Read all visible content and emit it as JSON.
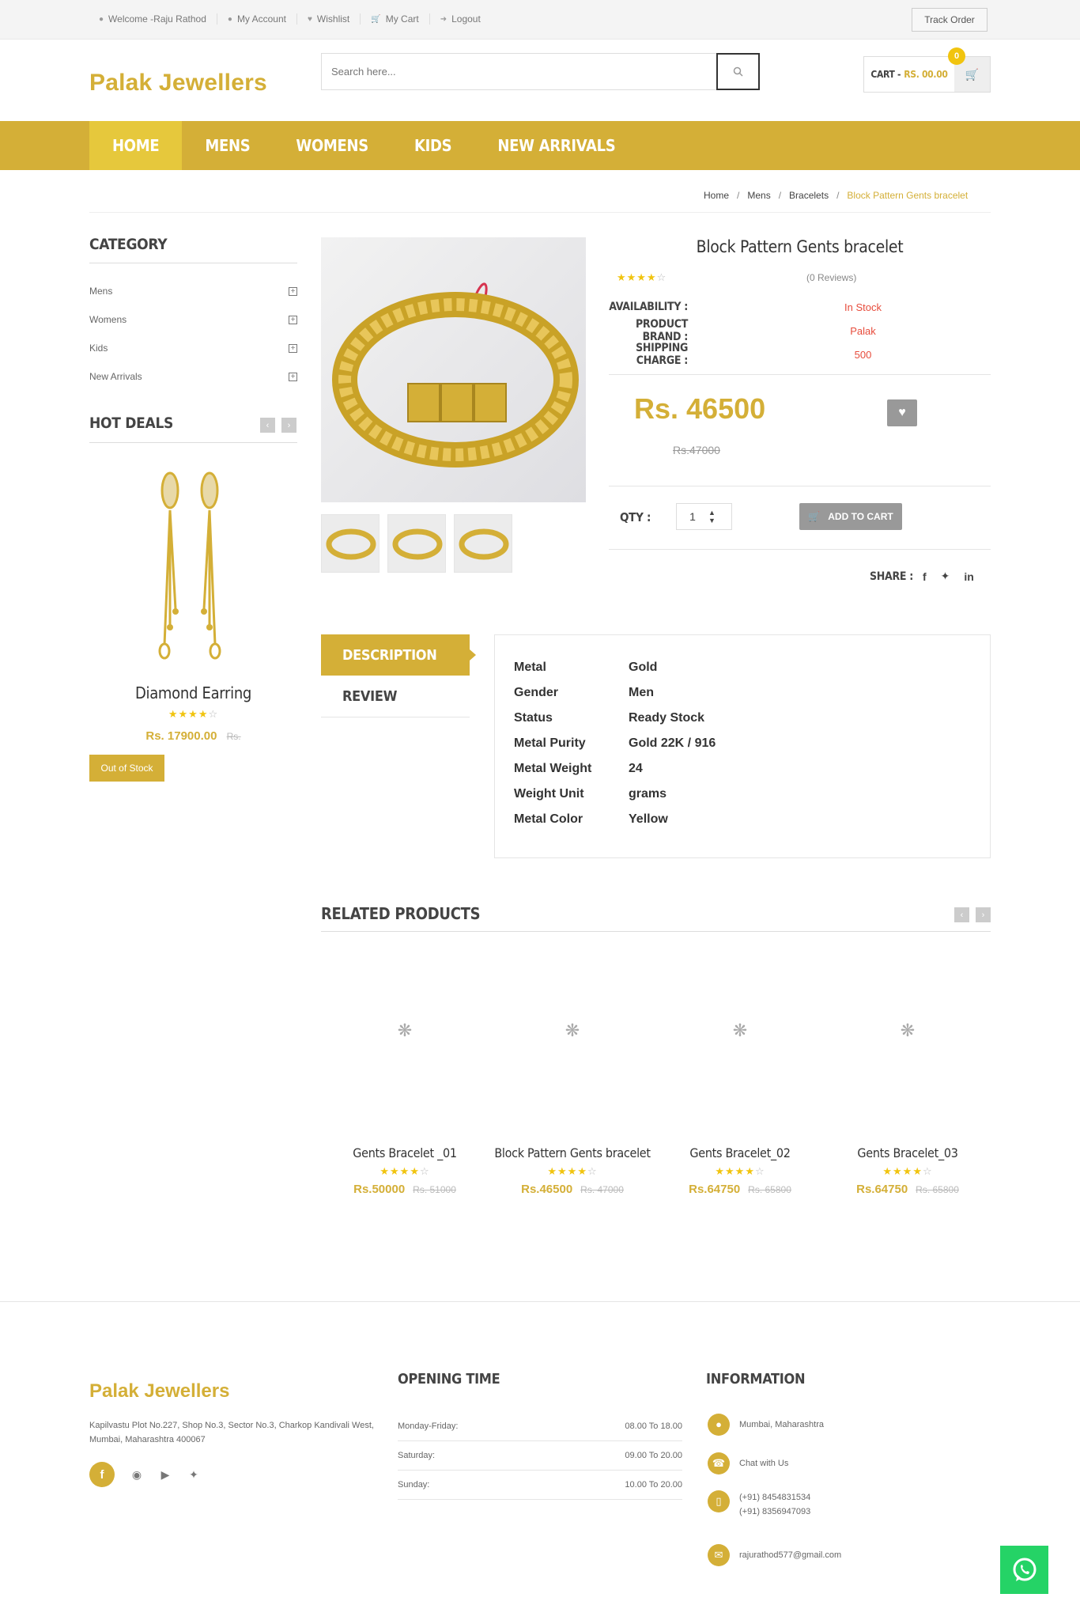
{
  "topbar": {
    "links": [
      {
        "icon": "user-icon",
        "label": "Welcome -Raju Rathod"
      },
      {
        "icon": "user-icon",
        "label": "My Account"
      },
      {
        "icon": "heart-icon",
        "label": "Wishlist"
      },
      {
        "icon": "cart-icon",
        "label": "My Cart"
      },
      {
        "icon": "logout-icon",
        "label": "Logout"
      }
    ],
    "track_order": "Track Order"
  },
  "header": {
    "logo": "Palak Jewellers",
    "search_placeholder": "Search here...",
    "cart_label": "CART -",
    "cart_value": "RS. 00.00",
    "cart_count": "0"
  },
  "nav": {
    "items": [
      "HOME",
      "MENS",
      "WOMENS",
      "KIDS",
      "NEW ARRIVALS"
    ],
    "active": "HOME"
  },
  "breadcrumb": [
    "Home",
    "Mens",
    "Bracelets",
    "Block Pattern Gents bracelet"
  ],
  "sidebar": {
    "category_title": "CATEGORY",
    "categories": [
      "Mens",
      "Womens",
      "Kids",
      "New Arrivals"
    ],
    "hot_deals_title": "HOT DEALS",
    "deal": {
      "name": "Diamond Earring",
      "rating": 4,
      "price": "Rs. 17900.00",
      "old_price": "Rs.",
      "status": "Out of Stock"
    }
  },
  "product": {
    "title": "Block Pattern Gents bracelet",
    "rating": 4,
    "reviews": "(0 Reviews)",
    "availability_label": "AVAILABILITY :",
    "availability": "In Stock",
    "brand_label": "PRODUCT BRAND :",
    "brand": "Palak",
    "shipping_label": "SHIPPING CHARGE :",
    "shipping": "500",
    "price": "Rs. 46500",
    "old_price": "Rs.47000",
    "qty_label": "QTY :",
    "qty": "1",
    "add_to_cart": "ADD TO CART",
    "share_label": "SHARE :"
  },
  "tabs": {
    "description": "DESCRIPTION",
    "review": "REVIEW"
  },
  "specs": [
    {
      "k": "Metal",
      "v": "Gold"
    },
    {
      "k": "Gender",
      "v": "Men"
    },
    {
      "k": "Status",
      "v": "Ready Stock"
    },
    {
      "k": "Metal Purity",
      "v": "Gold 22K / 916"
    },
    {
      "k": "Metal Weight",
      "v": "24"
    },
    {
      "k": "Weight Unit",
      "v": "grams"
    },
    {
      "k": "Metal Color",
      "v": "Yellow"
    }
  ],
  "related": {
    "title": "RELATED PRODUCTS",
    "products": [
      {
        "name": "Gents Bracelet _01",
        "rating": 4,
        "price": "Rs.50000",
        "old_price": "Rs. 51000"
      },
      {
        "name": "Block Pattern Gents bracelet",
        "rating": 4,
        "price": "Rs.46500",
        "old_price": "Rs. 47000"
      },
      {
        "name": "Gents Bracelet_02",
        "rating": 4,
        "price": "Rs.64750",
        "old_price": "Rs. 65800"
      },
      {
        "name": "Gents Bracelet_03",
        "rating": 4,
        "price": "Rs.64750",
        "old_price": "Rs. 65800"
      }
    ]
  },
  "footer": {
    "logo": "Palak Jewellers",
    "address": "Kapilvastu Plot No.227, Shop No.3, Sector No.3, Charkop Kandivali West, Mumbai, Maharashtra 400067",
    "opening_title": "OPENING TIME",
    "hours": [
      {
        "day": "Monday-Friday:",
        "time": "08.00 To 18.00"
      },
      {
        "day": "Saturday:",
        "time": "09.00 To 20.00"
      },
      {
        "day": "Sunday:",
        "time": "10.00 To 20.00"
      }
    ],
    "info_title": "INFORMATION",
    "location": "Mumbai, Maharashtra",
    "chat": "Chat with Us",
    "phone1": "(+91) 8454831534",
    "phone2": "(+91) 8356947093",
    "email": "rajurathod577@gmail.com"
  },
  "colors": {
    "accent": "#d4af37",
    "stock": "#e74c3c",
    "whatsapp": "#25d366"
  }
}
